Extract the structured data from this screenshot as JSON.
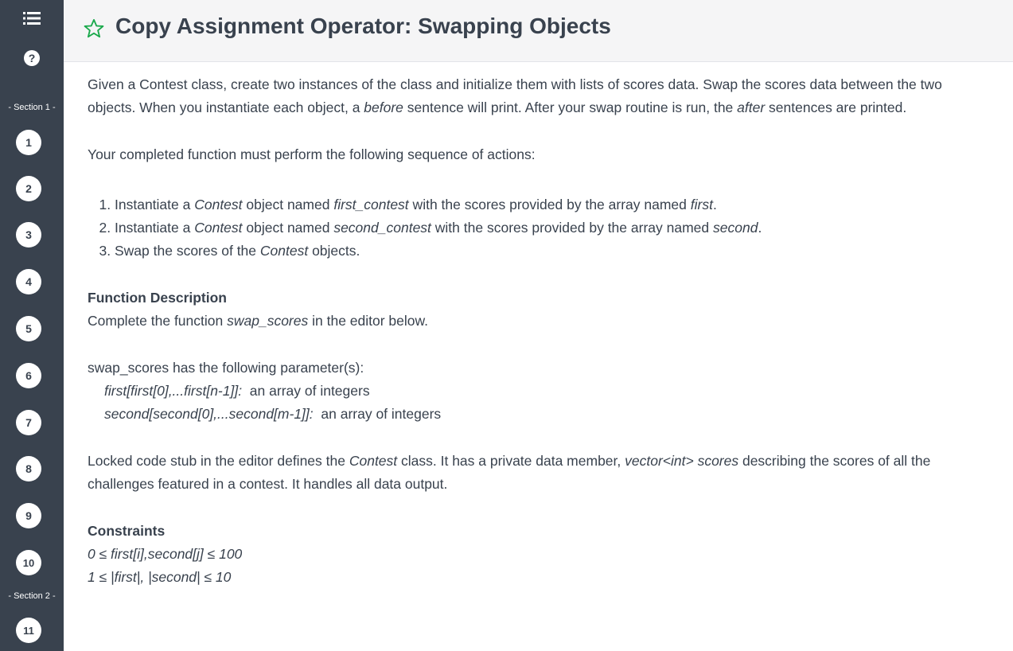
{
  "sidebar": {
    "section1_label": "- Section 1 -",
    "section2_label": "- Section 2 -",
    "help_glyph": "?",
    "questions": [
      "1",
      "2",
      "3",
      "4",
      "5",
      "6",
      "7",
      "8",
      "9",
      "10",
      "11"
    ]
  },
  "header": {
    "title": "Copy Assignment Operator: Swapping Objects"
  },
  "intro": {
    "p1": "Given a Contest class, create two instances of the class and initialize them with lists of scores data. Swap the scores data between the two objects. When you instantiate each object, a ",
    "p1_em1": "before",
    "p1_mid": " sentence will print. After your swap routine is run, the ",
    "p1_em2": "after",
    "p1_end": " sentences are printed.",
    "p2": "Your completed function must perform the following sequence of actions:"
  },
  "steps": [
    {
      "a": "Instantiate a ",
      "b": "Contest",
      "c": " object named ",
      "d": "first_contest",
      "e": " with the scores provided by the array named ",
      "f": "first",
      "g": "."
    },
    {
      "a": "Instantiate a ",
      "b": "Contest",
      "c": " object named ",
      "d": "second_contest",
      "e": " with the scores provided by the array named ",
      "f": "second",
      "g": "."
    },
    {
      "a": "Swap the scores of the ",
      "b": "Contest",
      "c": " objects."
    }
  ],
  "function_description": {
    "heading": "Function Description",
    "line_pre": "Complete the function ",
    "line_fn": "swap_scores",
    "line_post": " in the editor below.",
    "params_intro": "swap_scores has the following parameter(s):",
    "params": [
      {
        "name": "first[first[0],...first[n-1]]:",
        "desc": "  an array of integers"
      },
      {
        "name": "second[second[0],...second[m-1]]:",
        "desc": "  an array of integers"
      }
    ]
  },
  "stub": {
    "pre": "Locked code stub in the editor defines the ",
    "cls": "Contest",
    "mid": " class. It has a private data member, ",
    "member": "vector<int> scores",
    "post": " describing the scores of all the challenges featured in a contest. It handles all data output."
  },
  "constraints": {
    "heading": "Constraints",
    "lines": [
      "0 ≤ first[i],second[j] ≤ 100",
      "1 ≤ |first|, |second| ≤ 10"
    ]
  },
  "colors": {
    "sidebar": "#39424e",
    "header_bg": "#f5f5f6",
    "star": "#1ba94c",
    "text": "#39424e"
  }
}
